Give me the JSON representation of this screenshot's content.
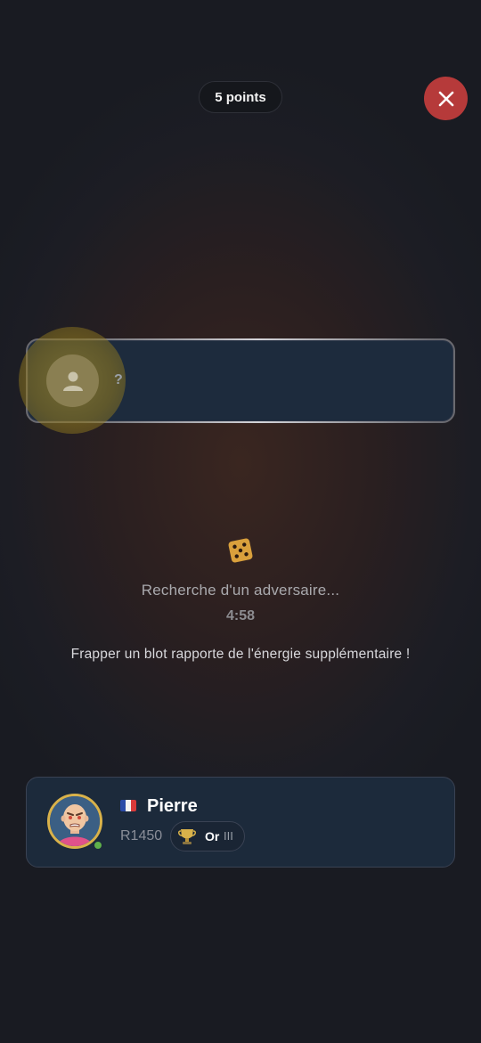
{
  "header": {
    "points_label": "5 points",
    "close_icon": "close-icon"
  },
  "opponent": {
    "name": "?",
    "avatar_icon": "user-placeholder-icon"
  },
  "matchmaking": {
    "dice_icon": "dice-icon",
    "status_text": "Recherche d'un adversaire...",
    "timer": "4:58",
    "tip": "Frapper un blot rapporte de l'énergie supplémentaire !"
  },
  "player": {
    "flag_icon": "france-flag-icon",
    "name": "Pierre",
    "rating": "R1450",
    "rank_icon": "trophy-icon",
    "rank_label": "Or",
    "rank_tier": "III",
    "online": true
  },
  "colors": {
    "close_button": "#b63a3a",
    "dice": "#d9a03c",
    "avatar_border": "#d9b24a",
    "online_dot": "#5fb04a"
  }
}
